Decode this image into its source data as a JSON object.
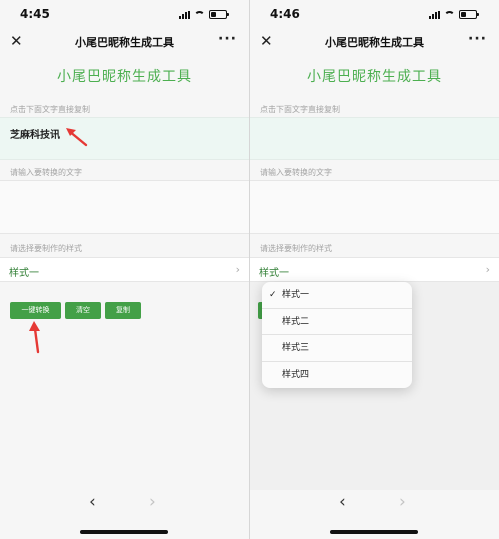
{
  "shared": {
    "nav_title": "小尾巴昵称生成工具",
    "close_icon": "✕",
    "more_icon": "···",
    "page_heading": "小尾巴昵称生成工具",
    "copy_hint": "点击下面文字直接复制",
    "input_hint": "请输入要转换的文字",
    "style_hint": "请选择要制作的样式",
    "selected_style": "样式一",
    "chevron_right": "›",
    "back_icon": "‹",
    "forward_icon": "›"
  },
  "left": {
    "time": "4:45",
    "copy_text": "芝麻科技讯",
    "buttons": {
      "convert": "一键转换",
      "clear": "清空",
      "copy": "复制"
    }
  },
  "right": {
    "time": "4:46",
    "check_mark": "✓",
    "options": [
      "样式一",
      "样式二",
      "样式三",
      "样式四"
    ]
  },
  "colors": {
    "accent_green": "#4caf50",
    "button_green": "#43a047",
    "annotation_red": "#e53935",
    "copy_box_bg": "#edf7f3"
  }
}
